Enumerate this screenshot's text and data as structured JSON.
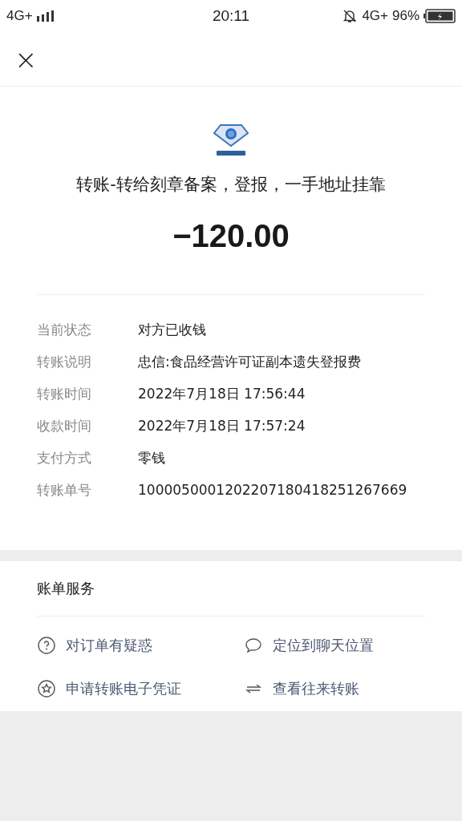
{
  "status_bar": {
    "left_network": "4G+",
    "time": "20:11",
    "right_network": "4G+",
    "battery": "96%"
  },
  "header": {
    "close": "×"
  },
  "payee": {
    "title": "转账-转给刻章备案，登报，一手地址挂靠",
    "amount": "−120.00"
  },
  "details": [
    {
      "label": "当前状态",
      "value": "对方已收钱"
    },
    {
      "label": "转账说明",
      "value": "忠信:食品经营许可证副本遗失登报费"
    },
    {
      "label": "转账时间",
      "value": "2022年7月18日 17:56:44"
    },
    {
      "label": "收款时间",
      "value": "2022年7月18日 17:57:24"
    },
    {
      "label": "支付方式",
      "value": "零钱"
    },
    {
      "label": "转账单号",
      "value": "1000050001202207180418251267669"
    }
  ],
  "services": {
    "title": "账单服务",
    "actions": [
      {
        "kind": "question",
        "label": "对订单有疑惑"
      },
      {
        "kind": "chat",
        "label": "定位到聊天位置"
      },
      {
        "kind": "star",
        "label": "申请转账电子凭证"
      },
      {
        "kind": "swap",
        "label": "查看往来转账"
      }
    ]
  }
}
